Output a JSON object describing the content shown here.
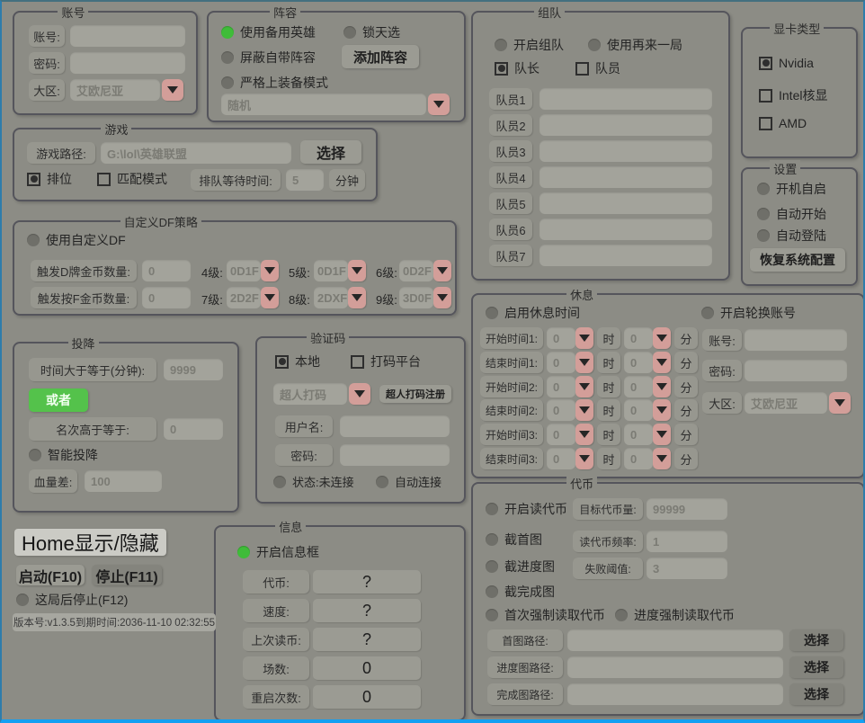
{
  "account": {
    "title": "账号",
    "username_label": "账号:",
    "password_label": "密码:",
    "region_label": "大区:",
    "region_value": "艾欧尼亚"
  },
  "lineup": {
    "title": "阵容",
    "use_backup_hero": "使用备用英雄",
    "lock_chosen": "锁天选",
    "block_builtin": "屏蔽自带阵容",
    "add_lineup_button": "添加阵容",
    "strict_equip_mode": "严格上装备模式",
    "lineup_select_value": "随机"
  },
  "team": {
    "title": "组队",
    "enable_team": "开启组队",
    "use_again": "使用再来一局",
    "captain": "队长",
    "member": "队员",
    "members": [
      "队员1",
      "队员2",
      "队员3",
      "队员4",
      "队员5",
      "队员6",
      "队员7"
    ]
  },
  "gpu": {
    "title": "显卡类型",
    "nvidia": "Nvidia",
    "intel": "Intel核显",
    "amd": "AMD"
  },
  "settings": {
    "title": "设置",
    "auto_boot": "开机自启",
    "auto_start": "自动开始",
    "auto_login": "自动登陆",
    "restore_button": "恢复系统配置"
  },
  "game": {
    "title": "游戏",
    "path_label": "游戏路径:",
    "path_value": "G:\\lol\\英雄联盟",
    "select_button": "选择",
    "ranked": "排位",
    "match_mode": "匹配模式",
    "queue_wait_label": "排队等待时间:",
    "queue_wait_value": "5",
    "minutes": "分钟"
  },
  "df": {
    "title": "自定义DF策略",
    "use_custom": "使用自定义DF",
    "row1_label": "触发D牌金币数量:",
    "row1_value": "0",
    "row2_label": "触发按F金币数量:",
    "row2_value": "0",
    "levels": [
      {
        "label": "4级:",
        "value": "0D1F"
      },
      {
        "label": "5级:",
        "value": "0D1F"
      },
      {
        "label": "6级:",
        "value": "0D2F"
      },
      {
        "label": "7级:",
        "value": "2D2F"
      },
      {
        "label": "8级:",
        "value": "2DXF"
      },
      {
        "label": "9级:",
        "value": "3D0F"
      }
    ]
  },
  "surrender": {
    "title": "投降",
    "time_label": "时间大于等于(分钟):",
    "time_value": "9999",
    "or_button": "或者",
    "rank_label": "名次高于等于:",
    "rank_value": "0",
    "smart": "智能投降",
    "hp_label": "血量差:",
    "hp_value": "100"
  },
  "captcha": {
    "title": "验证码",
    "local": "本地",
    "platform": "打码平台",
    "provider_value": "超人打码",
    "register_button": "超人打码注册",
    "username_label": "用户名:",
    "password_label": "密码:",
    "status": "状态:未连接",
    "auto_connect": "自动连接"
  },
  "rest": {
    "title": "休息",
    "enable": "启用休息时间",
    "rotate": "开启轮换账号",
    "rows": [
      "开始时间1:",
      "结束时间1:",
      "开始时间2:",
      "结束时间2:",
      "开始时间3:",
      "结束时间3:"
    ],
    "hour_value": "0",
    "hour_unit": "时",
    "minute_value": "0",
    "minute_unit": "分",
    "account_label": "账号:",
    "password_label": "密码:",
    "region_label": "大区:",
    "region_value": "艾欧尼亚"
  },
  "token": {
    "title": "代币",
    "enable_read": "开启读代币",
    "target_label": "目标代币量:",
    "target_value": "99999",
    "cap_first": "截首图",
    "freq_label": "读代币频率:",
    "freq_value": "1",
    "cap_progress": "截进度图",
    "fail_label": "失败阈值:",
    "fail_value": "3",
    "cap_done": "截完成图",
    "first_force": "首次强制读取代币",
    "progress_force": "进度强制读取代币",
    "paths": [
      {
        "label": "首图路径:",
        "button": "选择"
      },
      {
        "label": "进度图路径:",
        "button": "选择"
      },
      {
        "label": "完成图路径:",
        "button": "选择"
      }
    ]
  },
  "info": {
    "title": "信息",
    "enable": "开启信息框",
    "rows": [
      {
        "label": "代币:",
        "value": "?"
      },
      {
        "label": "速度:",
        "value": "?"
      },
      {
        "label": "上次读币:",
        "value": "?"
      },
      {
        "label": "场数:",
        "value": "0"
      },
      {
        "label": "重启次数:",
        "value": "0"
      }
    ]
  },
  "controls": {
    "home_toggle": "Home显示/隐藏",
    "start_button": "启动(F10)",
    "stop_button": "停止(F11)",
    "stop_after": "这局后停止(F12)",
    "version": "版本号:v1.3.5到期时间:2036-11-10 02:32:55"
  }
}
